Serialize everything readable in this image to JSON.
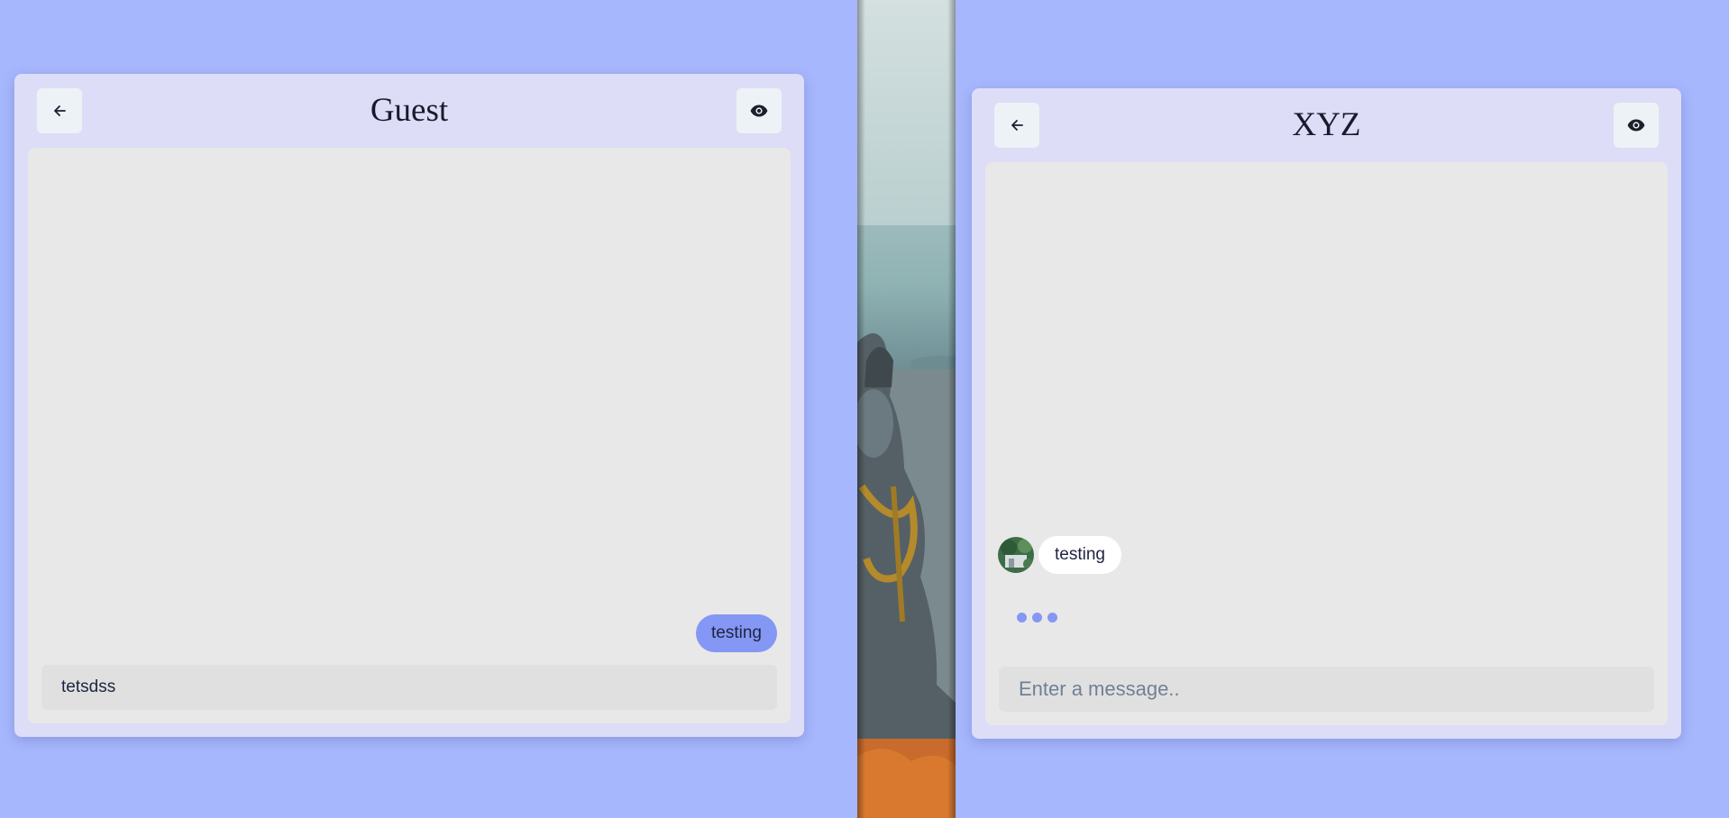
{
  "left_chat": {
    "title": "Guest",
    "back_icon": "arrow-left-icon",
    "view_icon": "eye-icon",
    "sent_message": "testing",
    "input_value": "tetsdss"
  },
  "right_chat": {
    "title": "XYZ",
    "back_icon": "arrow-left-icon",
    "view_icon": "eye-icon",
    "received_message": "testing",
    "typing_indicator": "three-dots",
    "input_placeholder": "Enter a message.."
  },
  "colors": {
    "page_background": "#a7b7fd",
    "panel": "#ddddf7",
    "chat_area": "#e8e8e8",
    "sent_bubble": "#8597f4",
    "received_bubble": "#ffffff",
    "typing_dots": "#8597f4"
  }
}
